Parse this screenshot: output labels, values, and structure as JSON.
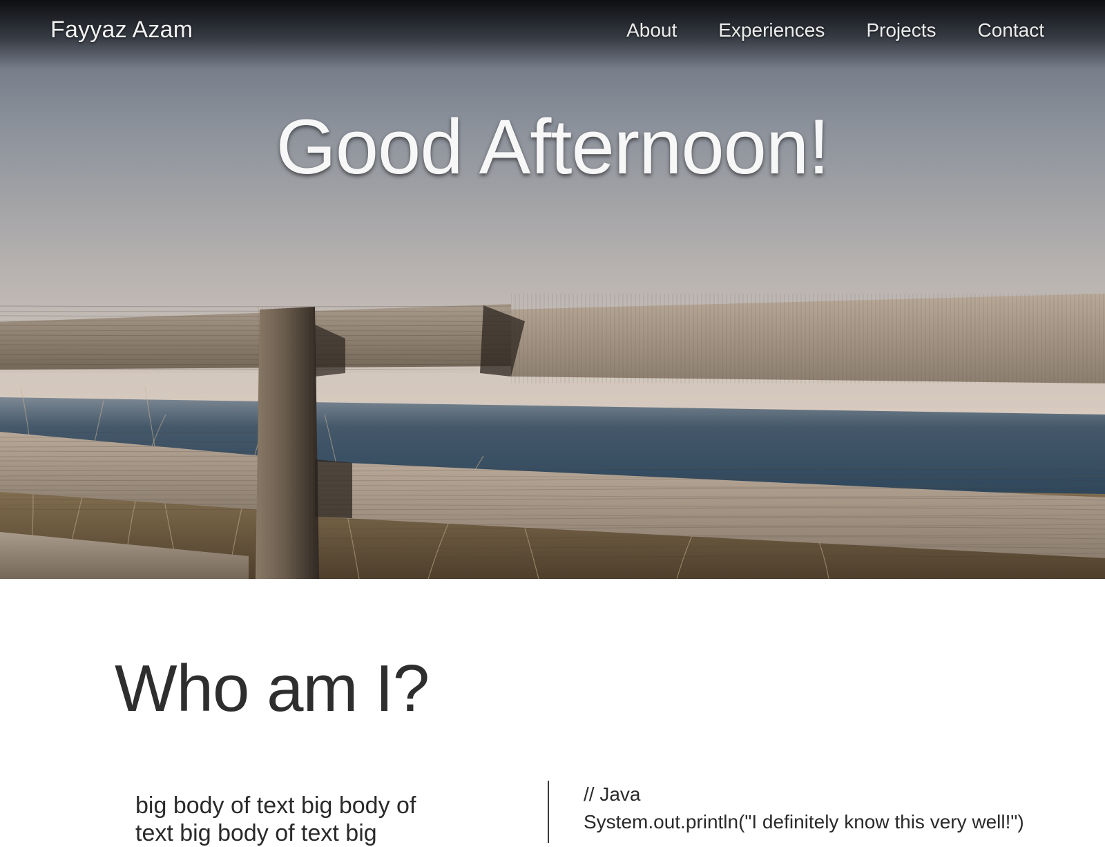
{
  "navbar": {
    "brand": "Fayyaz Azam",
    "links": [
      {
        "label": "About"
      },
      {
        "label": "Experiences"
      },
      {
        "label": "Projects"
      },
      {
        "label": "Contact"
      }
    ]
  },
  "hero": {
    "greeting": "Good Afternoon!"
  },
  "about": {
    "heading": "Who am I?",
    "body": "big body of text big body of text big body of text big",
    "code_comment": "// Java",
    "code_line": "System.out.println(\"I definitely know this very well!\")"
  }
}
